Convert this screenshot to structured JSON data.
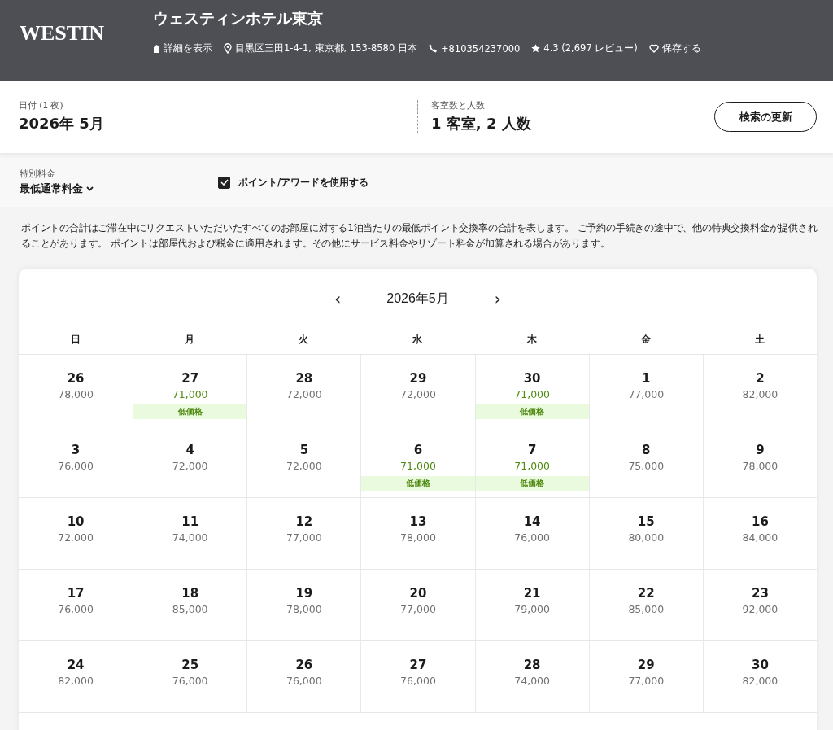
{
  "header": {
    "logo": "WESTIN",
    "hotel_name": "ウェスティンホテル東京",
    "links": [
      {
        "kind": "details",
        "text": "詳細を表示"
      },
      {
        "kind": "location",
        "text": "目黒区三田1-4-1, 東京都, 153-8580 日本"
      },
      {
        "kind": "phone",
        "text": "+810354237000"
      },
      {
        "kind": "rating",
        "text": "4.3 (2,697 レビュー)"
      },
      {
        "kind": "save",
        "text": "保存する"
      }
    ]
  },
  "search": {
    "date_label": "日付 (1 夜)",
    "date_value": "2026年 5月",
    "rooms_label": "客室数と人数",
    "rooms_value": "1 客室, 2 人数",
    "update_button": "検索の更新"
  },
  "filters": {
    "rate_label": "特別料金",
    "rate_value": "最低通常料金",
    "use_points": {
      "label": "ポイント/アワードを使用する",
      "checked": true
    }
  },
  "note": "ポイントの合計はご滞在中にリクエストいただいたすべてのお部屋に対する1泊当たりの最低ポイント交換率の合計を表します。 ご予約の手続きの途中で、他の特典交換料金が提供されることがあります。 ポイントは部屋代および税金に適用されます。その他にサービス料金やリゾート料金が加算される場合があります。",
  "calendar": {
    "month": "2026年5月",
    "prev": "‹",
    "next": "›",
    "weekdays": [
      "日",
      "月",
      "火",
      "水",
      "木",
      "金",
      "土"
    ],
    "weeks": [
      [
        {
          "day": "26",
          "price": "78,000",
          "low_price": false
        },
        {
          "day": "27",
          "price": "71,000",
          "low_price": true,
          "badge": "低価格"
        },
        {
          "day": "28",
          "price": "72,000",
          "low_price": false
        },
        {
          "day": "29",
          "price": "72,000",
          "low_price": false
        },
        {
          "day": "30",
          "price": "71,000",
          "low_price": true,
          "badge": "低価格"
        },
        {
          "day": "1",
          "price": "77,000",
          "low_price": false
        },
        {
          "day": "2",
          "price": "82,000",
          "low_price": false
        }
      ],
      [
        {
          "day": "3",
          "price": "76,000",
          "low_price": false
        },
        {
          "day": "4",
          "price": "72,000",
          "low_price": false
        },
        {
          "day": "5",
          "price": "72,000",
          "low_price": false
        },
        {
          "day": "6",
          "price": "71,000",
          "low_price": true,
          "badge": "低価格"
        },
        {
          "day": "7",
          "price": "71,000",
          "low_price": true,
          "badge": "低価格"
        },
        {
          "day": "8",
          "price": "75,000",
          "low_price": false
        },
        {
          "day": "9",
          "price": "78,000",
          "low_price": false
        }
      ],
      [
        {
          "day": "10",
          "price": "72,000",
          "low_price": false
        },
        {
          "day": "11",
          "price": "74,000",
          "low_price": false
        },
        {
          "day": "12",
          "price": "77,000",
          "low_price": false
        },
        {
          "day": "13",
          "price": "78,000",
          "low_price": false
        },
        {
          "day": "14",
          "price": "76,000",
          "low_price": false
        },
        {
          "day": "15",
          "price": "80,000",
          "low_price": false
        },
        {
          "day": "16",
          "price": "84,000",
          "low_price": false
        }
      ],
      [
        {
          "day": "17",
          "price": "76,000",
          "low_price": false
        },
        {
          "day": "18",
          "price": "85,000",
          "low_price": false
        },
        {
          "day": "19",
          "price": "78,000",
          "low_price": false
        },
        {
          "day": "20",
          "price": "77,000",
          "low_price": false
        },
        {
          "day": "21",
          "price": "79,000",
          "low_price": false
        },
        {
          "day": "22",
          "price": "85,000",
          "low_price": false
        },
        {
          "day": "23",
          "price": "92,000",
          "low_price": false
        }
      ],
      [
        {
          "day": "24",
          "price": "82,000",
          "low_price": false
        },
        {
          "day": "25",
          "price": "76,000",
          "low_price": false
        },
        {
          "day": "26",
          "price": "76,000",
          "low_price": false
        },
        {
          "day": "27",
          "price": "76,000",
          "low_price": false
        },
        {
          "day": "28",
          "price": "74,000",
          "low_price": false
        },
        {
          "day": "29",
          "price": "77,000",
          "low_price": false
        },
        {
          "day": "30",
          "price": "82,000",
          "low_price": false
        }
      ]
    ]
  }
}
